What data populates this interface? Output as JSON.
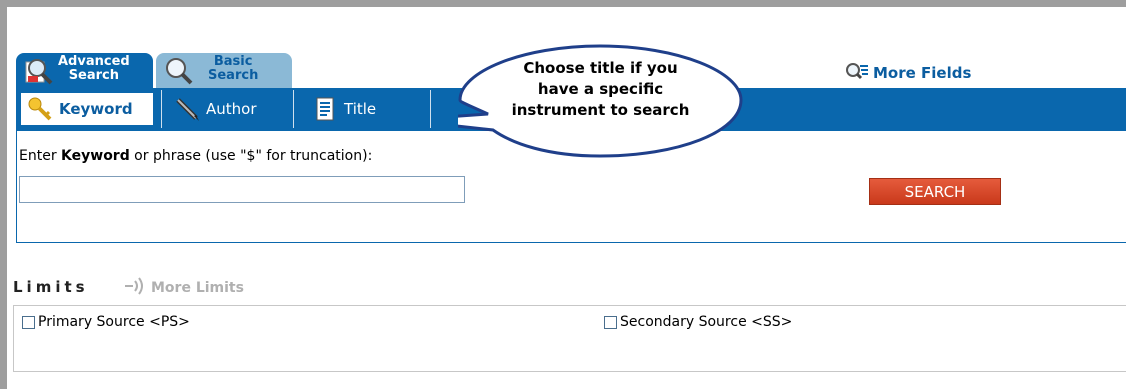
{
  "mode_tabs": [
    {
      "line1": "Advanced",
      "line2": "Search"
    },
    {
      "line1": "Basic",
      "line2": "Search"
    }
  ],
  "more_fields": "More Fields",
  "field_tabs": [
    {
      "label": "Keyword"
    },
    {
      "label": "Author"
    },
    {
      "label": "Title"
    }
  ],
  "callout": {
    "line1": "Choose title if you",
    "line2": "have a specific",
    "line3": "instrument to search"
  },
  "prompt": {
    "before": "Enter ",
    "bold": "Keyword",
    "after": " or phrase (use \"$\" for truncation):"
  },
  "search_input": {
    "value": ""
  },
  "search_button": "SEARCH",
  "limits": {
    "label": "Limits",
    "more_limits": "More Limits",
    "options": [
      {
        "label": "Primary Source <PS>",
        "checked": false
      },
      {
        "label": "Secondary Source <SS>",
        "checked": false
      }
    ]
  },
  "colors": {
    "primary_blue": "#0a67ad",
    "search_red": "#d8472a"
  }
}
